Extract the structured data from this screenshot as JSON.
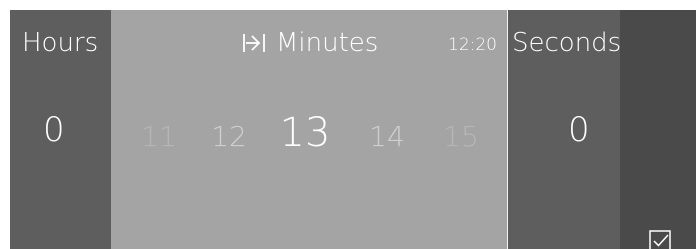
{
  "hours": {
    "label": "Hours",
    "value": "0"
  },
  "minutes": {
    "label": "Minutes",
    "tab_icon": "tab-arrow-icon",
    "clock": "12:20",
    "options": [
      "11",
      "12",
      "13",
      "14",
      "15"
    ],
    "selected": "13"
  },
  "seconds": {
    "label": "Seconds",
    "value": "0"
  },
  "confirm": {
    "icon": "checkbox-check-icon"
  },
  "colors": {
    "hours_bg": "#5e5e5e",
    "minutes_bg": "#a4a4a4",
    "seconds_bg": "#5e5e5e",
    "confirm_bg": "#4a4a4a",
    "text": "#ffffff"
  }
}
